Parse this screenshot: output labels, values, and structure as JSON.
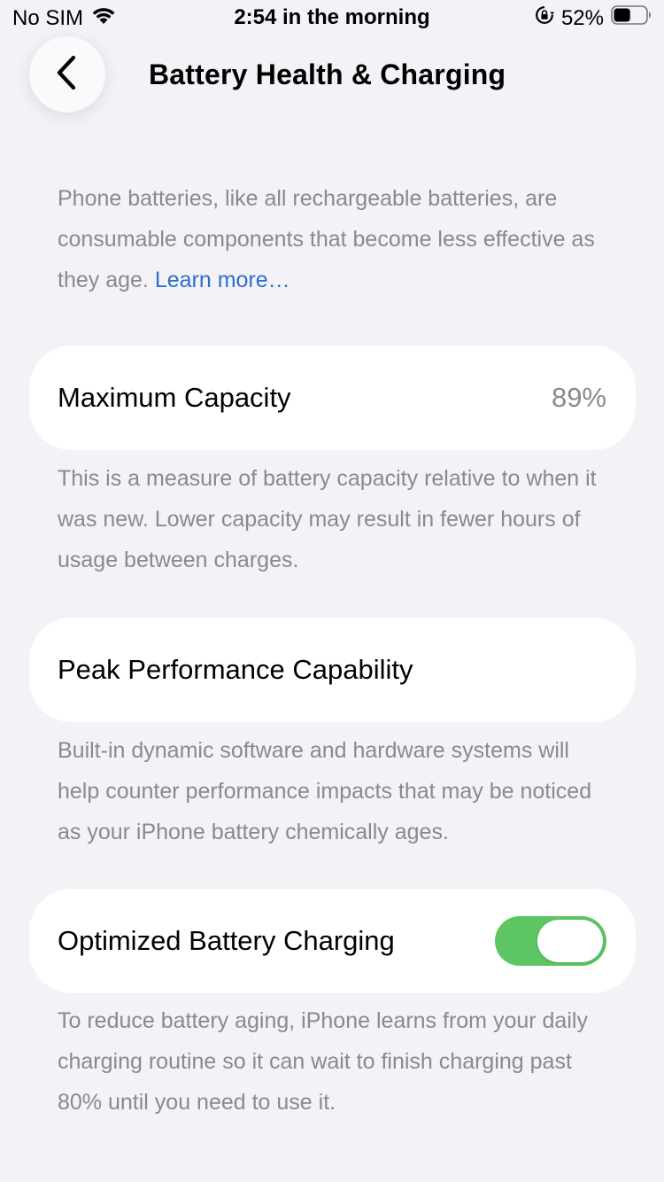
{
  "status_bar": {
    "carrier": "No SIM",
    "time": "2:54 in the morning",
    "battery_percent": "52%",
    "battery_level": 0.52,
    "icons": [
      "wifi-icon",
      "orientation-lock-icon",
      "battery-icon"
    ]
  },
  "nav": {
    "back_icon": "chevron-left-icon",
    "title": "Battery Health & Charging"
  },
  "intro": {
    "text": "Phone batteries, like all rechargeable batteries, are consumable components that become less effective as they age. ",
    "link": "Learn more…"
  },
  "maximum_capacity": {
    "label": "Maximum Capacity",
    "value": "89%",
    "description": "This is a measure of battery capacity relative to when it was new. Lower capacity may result in fewer hours of usage between charges."
  },
  "peak_performance": {
    "label": "Peak Performance Capability",
    "description": "Built-in dynamic software and hardware systems will help counter performance impacts that may be noticed as your iPhone battery chemically ages."
  },
  "optimized_charging": {
    "label": "Optimized Battery Charging",
    "enabled": true,
    "toggle_color": "#5dc563",
    "description": "To reduce battery aging, iPhone learns from your daily charging routine so it can wait to finish charging past 80% until you need to use it."
  },
  "colors": {
    "background": "#f2f2f7",
    "link": "#2d6fcf",
    "secondary_text": "#8a8a8e"
  }
}
